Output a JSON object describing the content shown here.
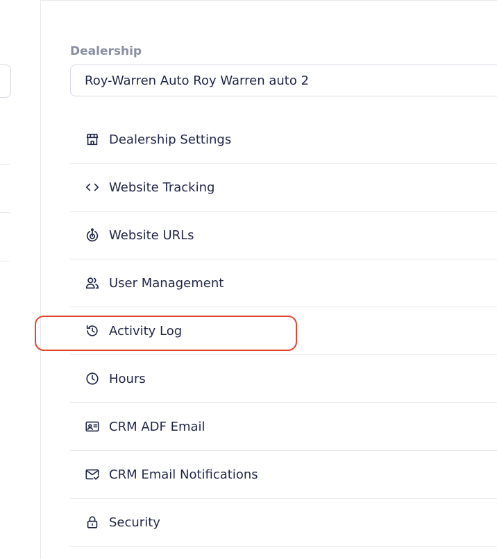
{
  "dealership": {
    "label": "Dealership",
    "selected": "Roy-Warren Auto Roy Warren auto 2"
  },
  "menu": [
    {
      "label": "Dealership Settings",
      "icon": "storefront-icon"
    },
    {
      "label": "Website Tracking",
      "icon": "code-icon"
    },
    {
      "label": "Website URLs",
      "icon": "target-icon"
    },
    {
      "label": "User Management",
      "icon": "users-icon"
    },
    {
      "label": "Activity Log",
      "icon": "history-icon"
    },
    {
      "label": "Hours",
      "icon": "clock-icon"
    },
    {
      "label": "CRM ADF Email",
      "icon": "id-card-icon"
    },
    {
      "label": "CRM Email Notifications",
      "icon": "mail-check-icon"
    },
    {
      "label": "Security",
      "icon": "lock-icon"
    }
  ],
  "highlight": {
    "target": "Activity Log",
    "color": "#e0472f"
  },
  "colors": {
    "text": "#1f2547",
    "label": "#8a8fa3",
    "border": "#e6e8ef"
  }
}
